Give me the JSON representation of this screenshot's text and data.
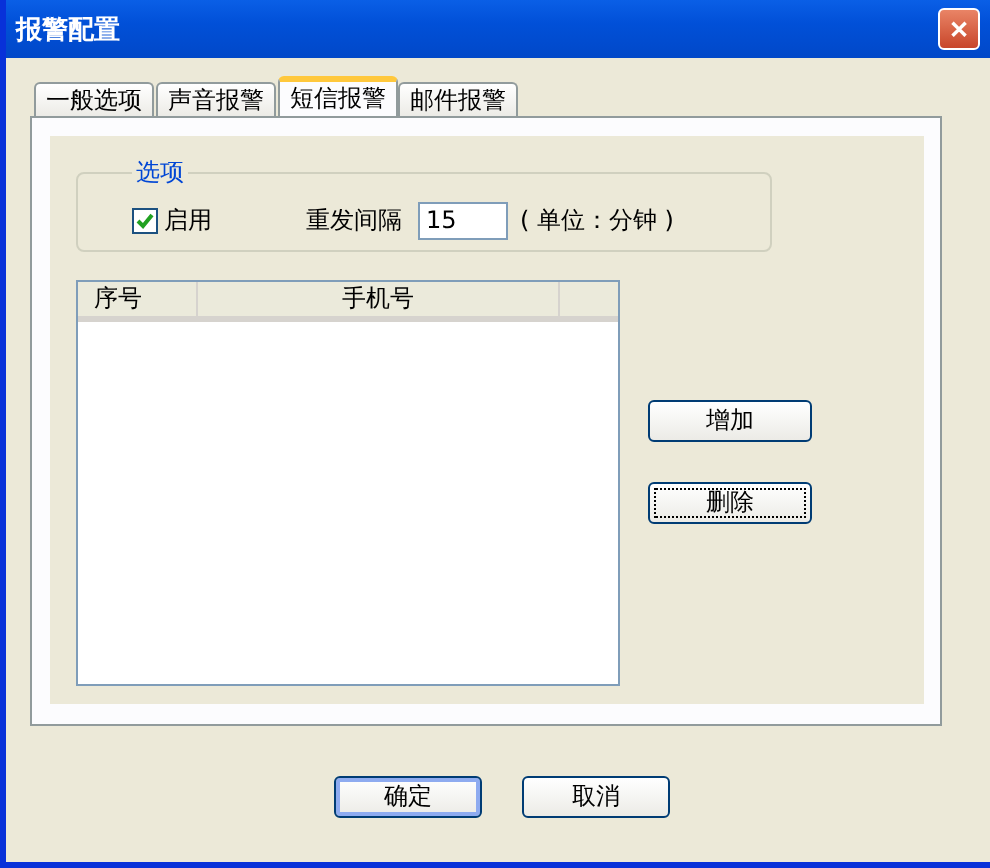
{
  "window": {
    "title": "报警配置",
    "close": "✕"
  },
  "tabs": [
    {
      "label": "一般选项",
      "selected": false
    },
    {
      "label": "声音报警",
      "selected": false
    },
    {
      "label": "短信报警",
      "selected": true
    },
    {
      "label": "邮件报警",
      "selected": false
    }
  ],
  "options": {
    "legend": "选项",
    "enable": {
      "label": "启用",
      "checked": true
    },
    "interval_label": "重发间隔",
    "interval_value": "15",
    "unit": "( 单位：分钟 )"
  },
  "table": {
    "columns": [
      "序号",
      "手机号"
    ]
  },
  "side_buttons": [
    {
      "label": "增加",
      "focused": false
    },
    {
      "label": "删除",
      "focused": true
    }
  ],
  "buttons": [
    {
      "label": "确定",
      "default": true
    },
    {
      "label": "取消",
      "default": false
    }
  ]
}
